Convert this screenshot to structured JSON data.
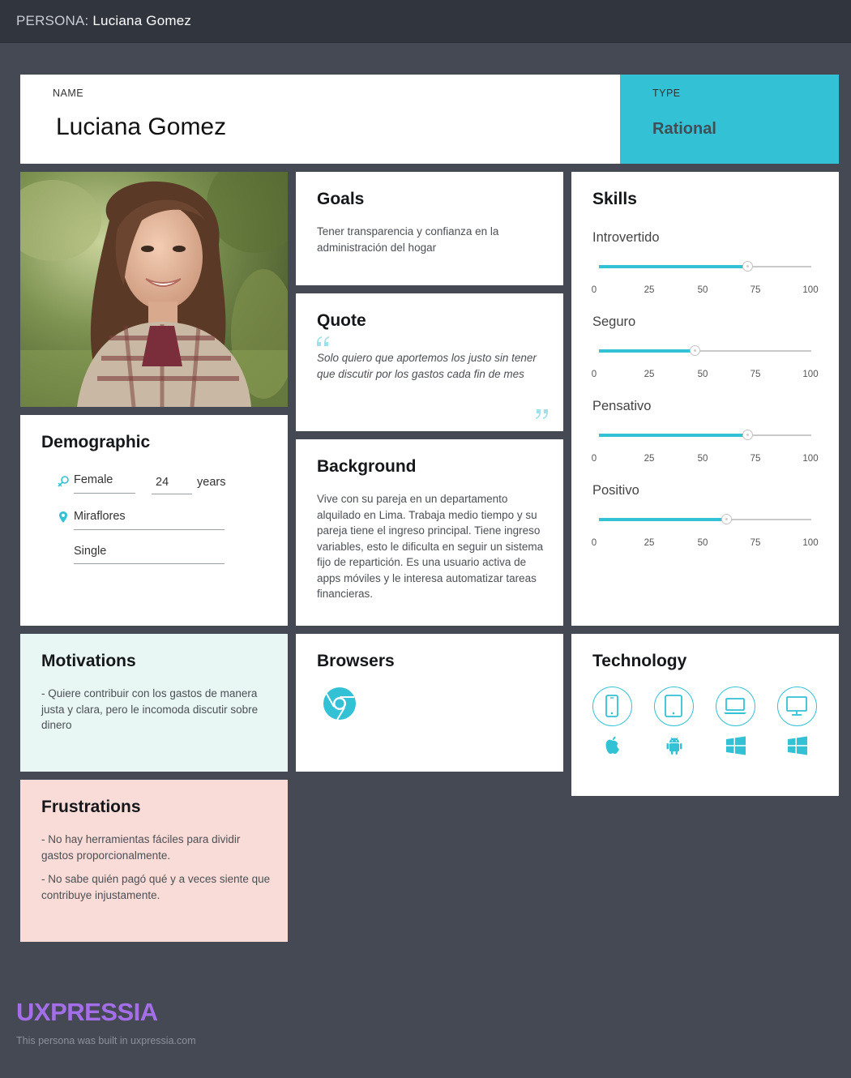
{
  "topbar": {
    "prefix": "PERSONA:",
    "title": "Luciana Gomez"
  },
  "header": {
    "name_label": "NAME",
    "name": "Luciana Gomez",
    "type_label": "TYPE",
    "type_value": "Rational"
  },
  "goals": {
    "title": "Goals",
    "text": "Tener transparencia y confianza en la administración del hogar"
  },
  "quote": {
    "title": "Quote",
    "text": "Solo quiero que aportemos los justo sin tener que discutir por los gastos cada fin de mes"
  },
  "background": {
    "title": "Background",
    "text": "Vive con su pareja en un departamento alquilado en Lima. Trabaja medio tiempo y su pareja tiene el ingreso principal. Tiene ingreso variables, esto le dificulta en seguir un sistema fijo de repartición. Es una usuario activa de apps móviles y le interesa automatizar tareas financieras."
  },
  "demographic": {
    "title": "Demographic",
    "gender": "Female",
    "age": "24",
    "age_unit": "years",
    "location": "Miraflores",
    "status": "Single"
  },
  "skills": {
    "title": "Skills",
    "ticks": [
      "0",
      "25",
      "50",
      "75",
      "100"
    ],
    "items": [
      {
        "label": "Introvertido",
        "value": 70
      },
      {
        "label": "Seguro",
        "value": 45
      },
      {
        "label": "Pensativo",
        "value": 70
      },
      {
        "label": "Positivo",
        "value": 60
      }
    ]
  },
  "motivations": {
    "title": "Motivations",
    "items": [
      "- Quiere contribuir con los gastos de manera justa y clara, pero le incomoda discutir sobre dinero"
    ]
  },
  "browsers": {
    "title": "Browsers",
    "items": [
      "chrome-icon"
    ]
  },
  "technology": {
    "title": "Technology",
    "devices": [
      "smartphone-icon",
      "tablet-icon",
      "laptop-icon",
      "desktop-icon"
    ],
    "platforms": [
      "apple-icon",
      "android-icon",
      "windows-icon",
      "windows-icon"
    ]
  },
  "frustrations": {
    "title": "Frustrations",
    "items": [
      "- No hay herramientas fáciles para dividir gastos proporcionalmente.",
      "- No sabe quién pagó qué y a veces siente que contribuye injustamente."
    ]
  },
  "colors": {
    "accent": "#33c1d6",
    "background": "#444954",
    "topbar": "#31353e",
    "motivations_bg": "#e8f7f4",
    "frustrations_bg": "#f9dcd7",
    "logo": "#a46ee8"
  },
  "footer": {
    "logo": "UXPRESSIA",
    "text": "This persona was built in uxpressia.com"
  }
}
